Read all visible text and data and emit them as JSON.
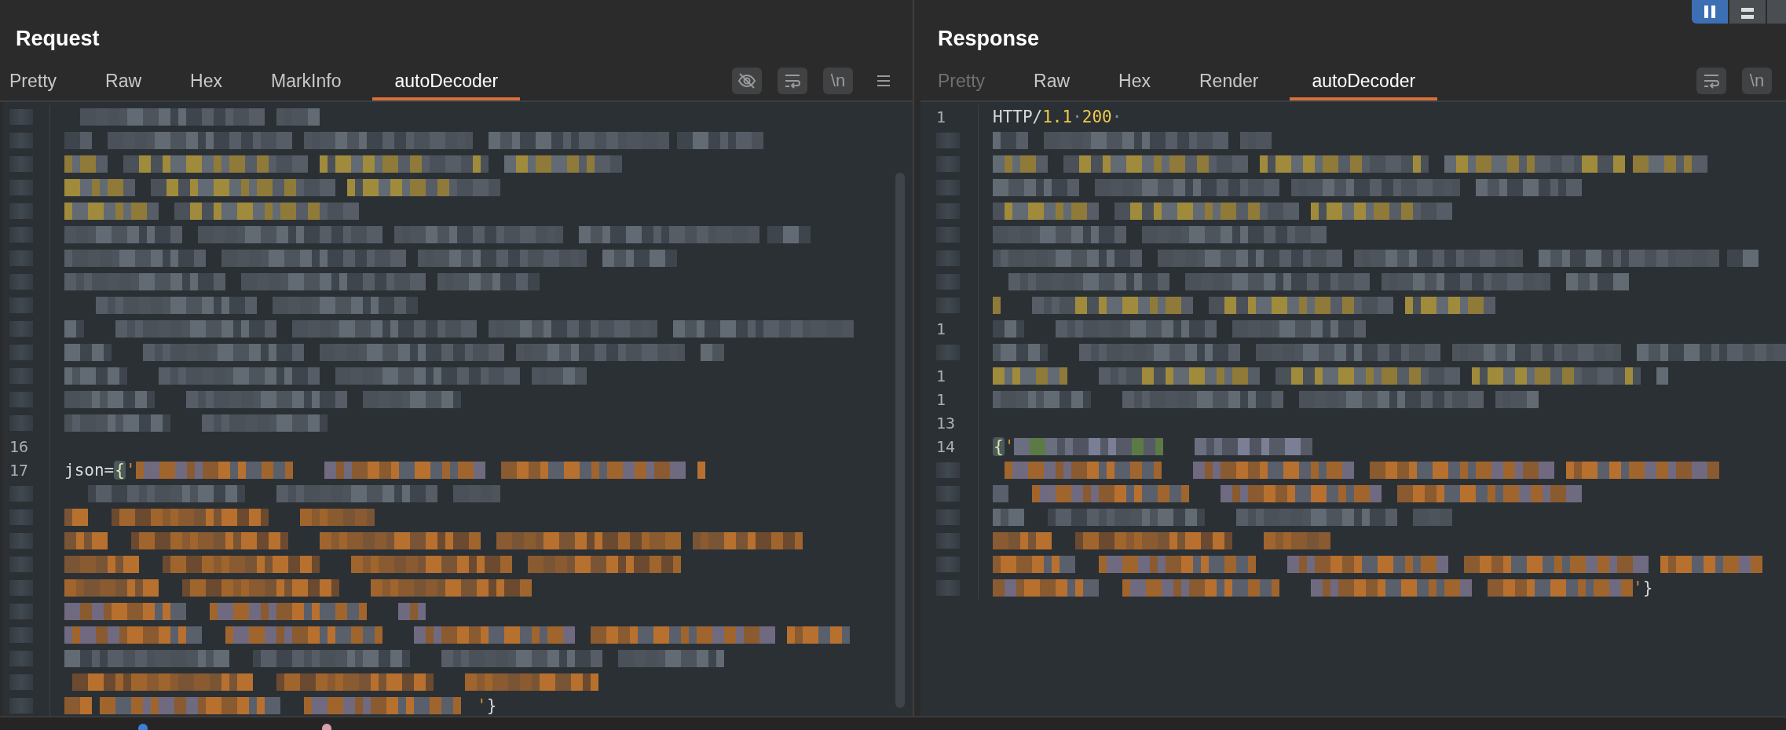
{
  "view_toggles": [
    {
      "kind": "columns",
      "selected": true
    },
    {
      "kind": "rows",
      "selected": false
    },
    {
      "kind": "partial",
      "selected": false
    }
  ],
  "panes": [
    {
      "title": "Request",
      "tabs": [
        {
          "label": "Pretty",
          "selected": false,
          "disabled": false
        },
        {
          "label": "Raw",
          "selected": false,
          "disabled": false
        },
        {
          "label": "Hex",
          "selected": false,
          "disabled": false
        },
        {
          "label": "MarkInfo",
          "selected": false,
          "disabled": false
        },
        {
          "label": "autoDecoder",
          "selected": true,
          "disabled": false
        }
      ],
      "actions": [
        {
          "kind": "hide"
        },
        {
          "kind": "wrap"
        },
        {
          "kind": "newline",
          "label": "\\n"
        },
        {
          "kind": "menu"
        }
      ],
      "scrollbar": true,
      "rows": [
        {
          "kind": "grey"
        },
        {
          "kind": "grey"
        },
        {
          "kind": "yellow"
        },
        {
          "kind": "yellow"
        },
        {
          "kind": "yellow"
        },
        {
          "kind": "grey"
        },
        {
          "kind": "grey"
        },
        {
          "kind": "grey"
        },
        {
          "kind": "grey"
        },
        {
          "kind": "grey"
        },
        {
          "kind": "grey"
        },
        {
          "kind": "grey"
        },
        {
          "kind": "grey"
        },
        {
          "kind": "grey"
        },
        {
          "kind": "code",
          "number": "16"
        },
        {
          "kind": "mixed",
          "number": "17",
          "segments": [
            {
              "kind": "plain",
              "text": "json="
            },
            {
              "kind": "brace",
              "text": "{"
            },
            {
              "kind": "quote",
              "text": "'"
            }
          ]
        },
        {
          "kind": "grey"
        },
        {
          "kind": "orange"
        },
        {
          "kind": "orange"
        },
        {
          "kind": "orange"
        },
        {
          "kind": "orange"
        },
        {
          "kind": "mixed"
        },
        {
          "kind": "mixed"
        },
        {
          "kind": "grey"
        },
        {
          "kind": "orange"
        },
        {
          "kind": "mixed",
          "tail": [
            {
              "kind": "quote",
              "text": "'"
            },
            {
              "kind": "plain",
              "text": "}"
            }
          ]
        }
      ]
    },
    {
      "title": "Response",
      "tabs": [
        {
          "label": "Pretty",
          "selected": false,
          "disabled": true
        },
        {
          "label": "Raw",
          "selected": false,
          "disabled": false
        },
        {
          "label": "Hex",
          "selected": false,
          "disabled": false
        },
        {
          "label": "Render",
          "selected": false,
          "disabled": false
        },
        {
          "label": "autoDecoder",
          "selected": true,
          "disabled": false
        }
      ],
      "actions": [
        {
          "kind": "wrap"
        },
        {
          "kind": "newline",
          "label": "\\n"
        }
      ],
      "rows": [
        {
          "kind": "code",
          "number": "1",
          "segments": [
            {
              "kind": "plain",
              "text": "HTTP/"
            },
            {
              "kind": "number",
              "text": "1.1"
            },
            {
              "kind": "space",
              "text": "·"
            },
            {
              "kind": "number",
              "text": "200"
            },
            {
              "kind": "space",
              "text": "·"
            }
          ]
        },
        {
          "kind": "grey"
        },
        {
          "kind": "yellow"
        },
        {
          "kind": "grey"
        },
        {
          "kind": "yellow"
        },
        {
          "kind": "grey"
        },
        {
          "kind": "grey"
        },
        {
          "kind": "grey"
        },
        {
          "kind": "yellow"
        },
        {
          "kind": "grey",
          "number": "1"
        },
        {
          "kind": "grey"
        },
        {
          "kind": "yellow",
          "number": "1"
        },
        {
          "kind": "grey",
          "number": "1"
        },
        {
          "kind": "code",
          "number": "13"
        },
        {
          "kind": "green",
          "number": "14",
          "segments": [
            {
              "kind": "brace",
              "text": "{"
            },
            {
              "kind": "quote",
              "text": "'"
            }
          ]
        },
        {
          "kind": "mixed"
        },
        {
          "kind": "mixed"
        },
        {
          "kind": "grey"
        },
        {
          "kind": "orange"
        },
        {
          "kind": "mixed"
        },
        {
          "kind": "mixed",
          "tail": [
            {
              "kind": "quote",
              "text": "'"
            },
            {
              "kind": "plain",
              "text": "}"
            }
          ]
        }
      ]
    }
  ],
  "status_dots": [
    {
      "color": "#3b82d6"
    },
    {
      "color": "#d9a0b0"
    }
  ]
}
